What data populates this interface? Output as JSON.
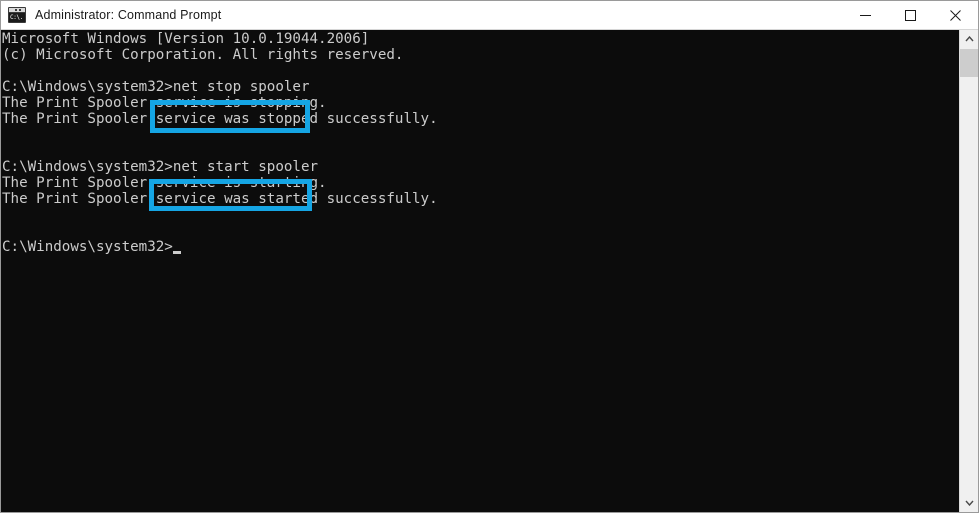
{
  "window": {
    "title": "Administrator: Command Prompt",
    "icon": "command-prompt-icon",
    "icon_glyph": "C:\\.",
    "background_color": "#0c0c0c",
    "text_color": "#cccccc",
    "titlebar_color": "#ffffff"
  },
  "controls": {
    "minimize_label": "Minimize",
    "maximize_label": "Maximize",
    "close_label": "Close"
  },
  "console": {
    "lines": [
      "Microsoft Windows [Version 10.0.19044.2006]",
      "(c) Microsoft Corporation. All rights reserved.",
      "",
      "C:\\Windows\\system32>net stop spooler",
      "The Print Spooler service is stopping.",
      "The Print Spooler service was stopped successfully.",
      "",
      "",
      "C:\\Windows\\system32>net start spooler",
      "The Print Spooler service is starting.",
      "The Print Spooler service was started successfully.",
      "",
      "",
      "C:\\Windows\\system32>"
    ],
    "prompt": "C:\\Windows\\system32>",
    "cursor_visible": true
  },
  "annotations": {
    "color": "#15a5e4",
    "boxes": [
      {
        "id": "highlight-net-stop-spooler",
        "label": "net stop spooler"
      },
      {
        "id": "highlight-net-start-spooler",
        "label": "net start spooler"
      }
    ]
  },
  "scrollbar": {
    "up_arrow": "chevron-up-icon",
    "down_arrow": "chevron-down-icon",
    "thumb_position_percent": 4
  }
}
